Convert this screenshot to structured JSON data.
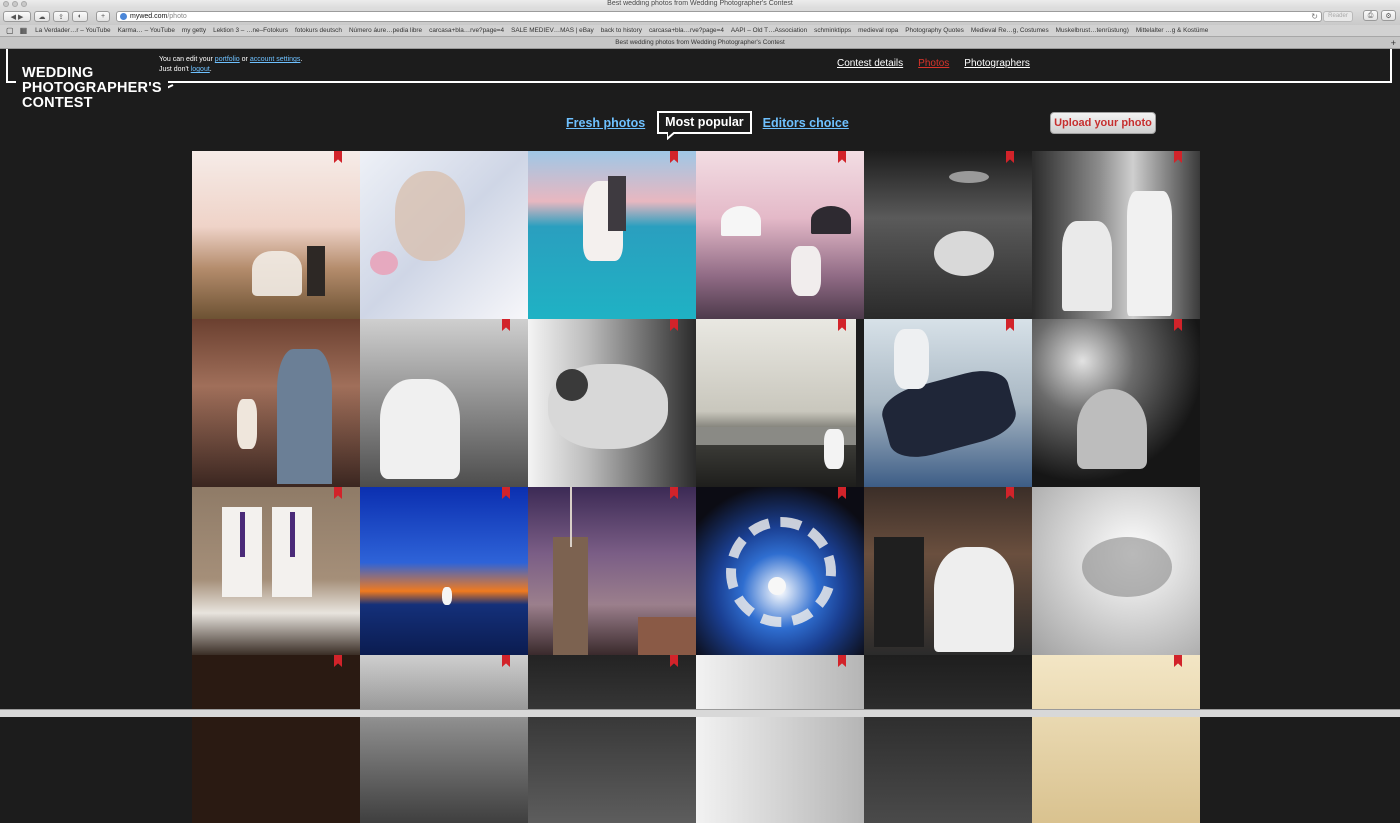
{
  "browser": {
    "window_title": "Best wedding photos from Wedding Photographer's Contest",
    "url_host": "mywed.com",
    "url_path": "/photo",
    "reader_label": "Reader",
    "tab_title": "Best wedding photos from Wedding Photographer's Contest",
    "bookmarks": [
      "La Verdader…r – YouTube",
      "Karma… – YouTube",
      "my getty",
      "Lektion 3 – …ne–Fotokurs",
      "fotokurs deutsch",
      "Número áure…pedia libre",
      "carcasa+bla…rve?page=4",
      "SALE MEDIEV…MAS | eBay",
      "back to history",
      "carcasa+bla…rve?page=4",
      "AAPI – Old T…Association",
      "schminktipps",
      "medieval ropa",
      "Photography Quotes",
      "Medieval Re…g, Costumes",
      "Muskelbrust…tenrüstung)",
      "Mittelalter …g & Kostüme"
    ]
  },
  "site": {
    "logo_lines": [
      "WEDDING",
      "PHOTOGRAPHER'S",
      "CONTEST"
    ],
    "edit_msg_prefix": "You can edit your",
    "portfolio_link": "portfolio",
    "edit_msg_or": "or",
    "account_link": "account settings",
    "edit_msg_end": ".",
    "just_dont": "Just don't",
    "logout_link": "logout",
    "nav": {
      "contest_details": "Contest details",
      "photos": "Photos",
      "photographers": "Photographers"
    },
    "filters": {
      "fresh": "Fresh photos",
      "popular": "Most popular",
      "editors": "Editors choice"
    },
    "upload_label": "Upload your photo"
  },
  "colors": {
    "accent_red": "#d9342b",
    "link_blue": "#6ec1ff",
    "bookmark_red": "#d2232a"
  }
}
